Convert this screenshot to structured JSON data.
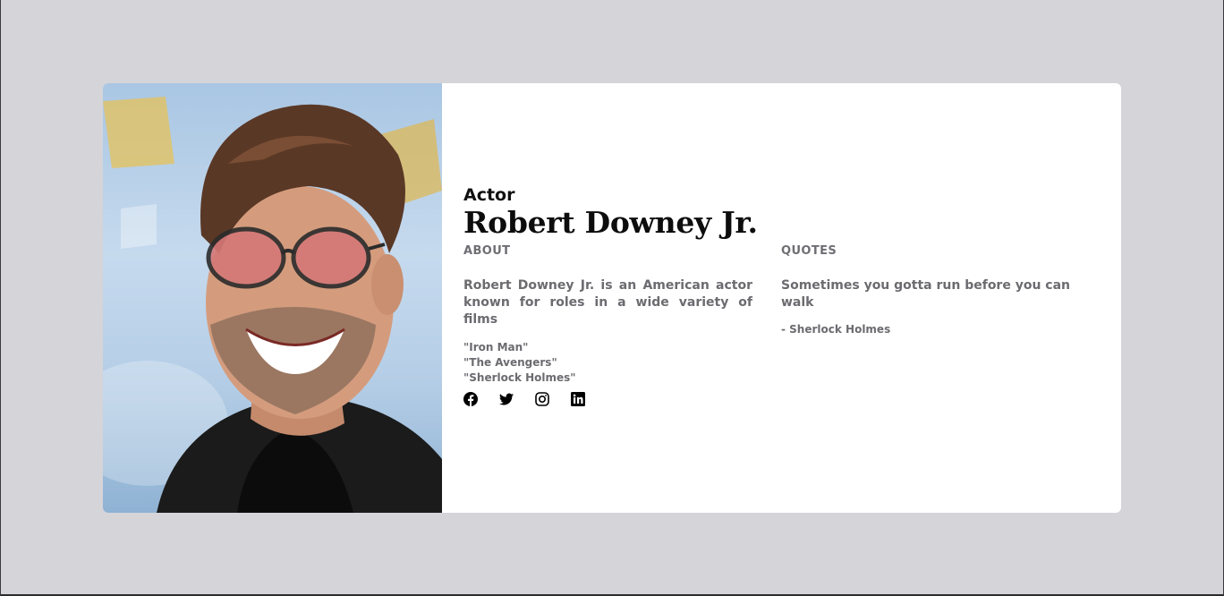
{
  "profile": {
    "role": "Actor",
    "name": "Robert Downey Jr.",
    "photo_icon": "portrait-photo"
  },
  "about": {
    "heading": "ABOUT",
    "text": "Robert Downey Jr. is an American actor known for roles in a wide variety of films",
    "films": [
      "\"Iron Man\"",
      "\"The Avengers\"",
      "\"Sherlock Holmes\""
    ]
  },
  "quotes": {
    "heading": "QUOTES",
    "text": "Sometimes you gotta run before you can walk",
    "author": "- Sherlock Holmes"
  },
  "socials": [
    {
      "icon": "facebook-icon"
    },
    {
      "icon": "twitter-icon"
    },
    {
      "icon": "instagram-icon"
    },
    {
      "icon": "linkedin-icon"
    }
  ],
  "colors": {
    "background": "#d5d4d9",
    "card": "#ffffff",
    "heading_text": "#0d0d0d",
    "body_text": "#6b6b70"
  }
}
